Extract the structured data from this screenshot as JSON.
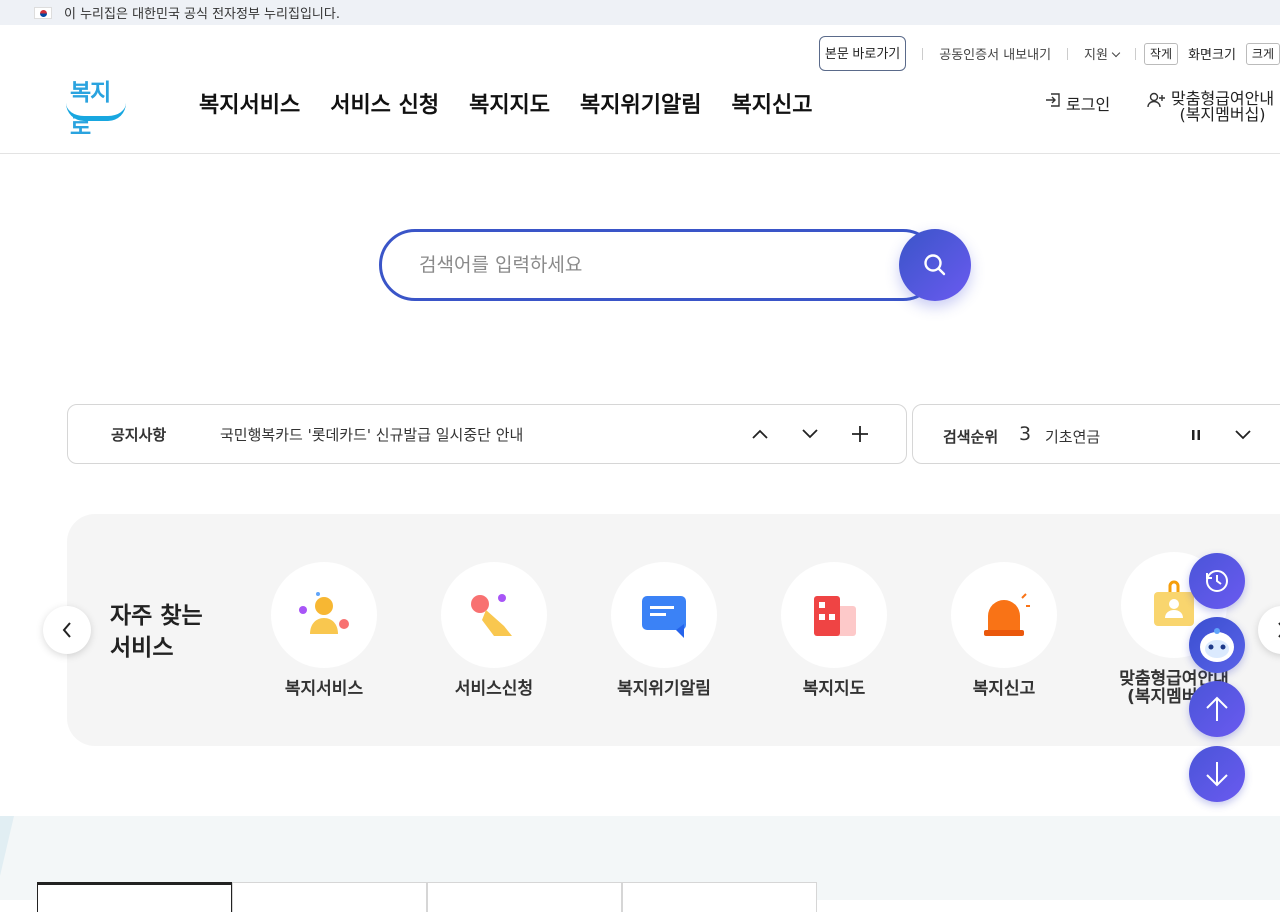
{
  "gov_banner": {
    "text": "이 누리집은 대한민국 공식 전자정부 누리집입니다."
  },
  "header": {
    "logo": "복지로",
    "util": {
      "skip_label": "본문 바로가기",
      "cert_label": "공동인증서 내보내기",
      "support_label": "지원",
      "small_label": "작게",
      "screen_size_label": "화면크기",
      "large_label": "크게"
    },
    "nav": [
      "복지서비스",
      "서비스 신청",
      "복지지도",
      "복지위기알림",
      "복지신고"
    ],
    "login_label": "로그인",
    "member_label_1": "맞춤형급여안내",
    "member_label_2": "(복지멤버십)"
  },
  "search": {
    "placeholder": "검색어를 입력하세요"
  },
  "notice": {
    "label": "공지사항",
    "text": "국민행복카드 '롯데카드' 신규발급 일시중단 안내"
  },
  "rank": {
    "label": "검색순위",
    "number": "3",
    "keyword": "기초연금"
  },
  "frequent": {
    "title_1": "자주 찾는",
    "title_2": "서비스",
    "items": [
      {
        "label_1": "복지서비스",
        "label_2": "",
        "icon": "person-icon"
      },
      {
        "label_1": "서비스신청",
        "label_2": "",
        "icon": "touch-icon"
      },
      {
        "label_1": "복지위기알림",
        "label_2": "",
        "icon": "chat-icon"
      },
      {
        "label_1": "복지지도",
        "label_2": "",
        "icon": "building-icon"
      },
      {
        "label_1": "복지신고",
        "label_2": "",
        "icon": "siren-icon"
      },
      {
        "label_1": "맞춤형급여안내",
        "label_2": "(복지멤버십)",
        "icon": "id-card-icon"
      }
    ]
  },
  "colors": {
    "accent": "#3a55c8",
    "accent2": "#6a5af0",
    "panel_bg": "#f5f5f5"
  }
}
